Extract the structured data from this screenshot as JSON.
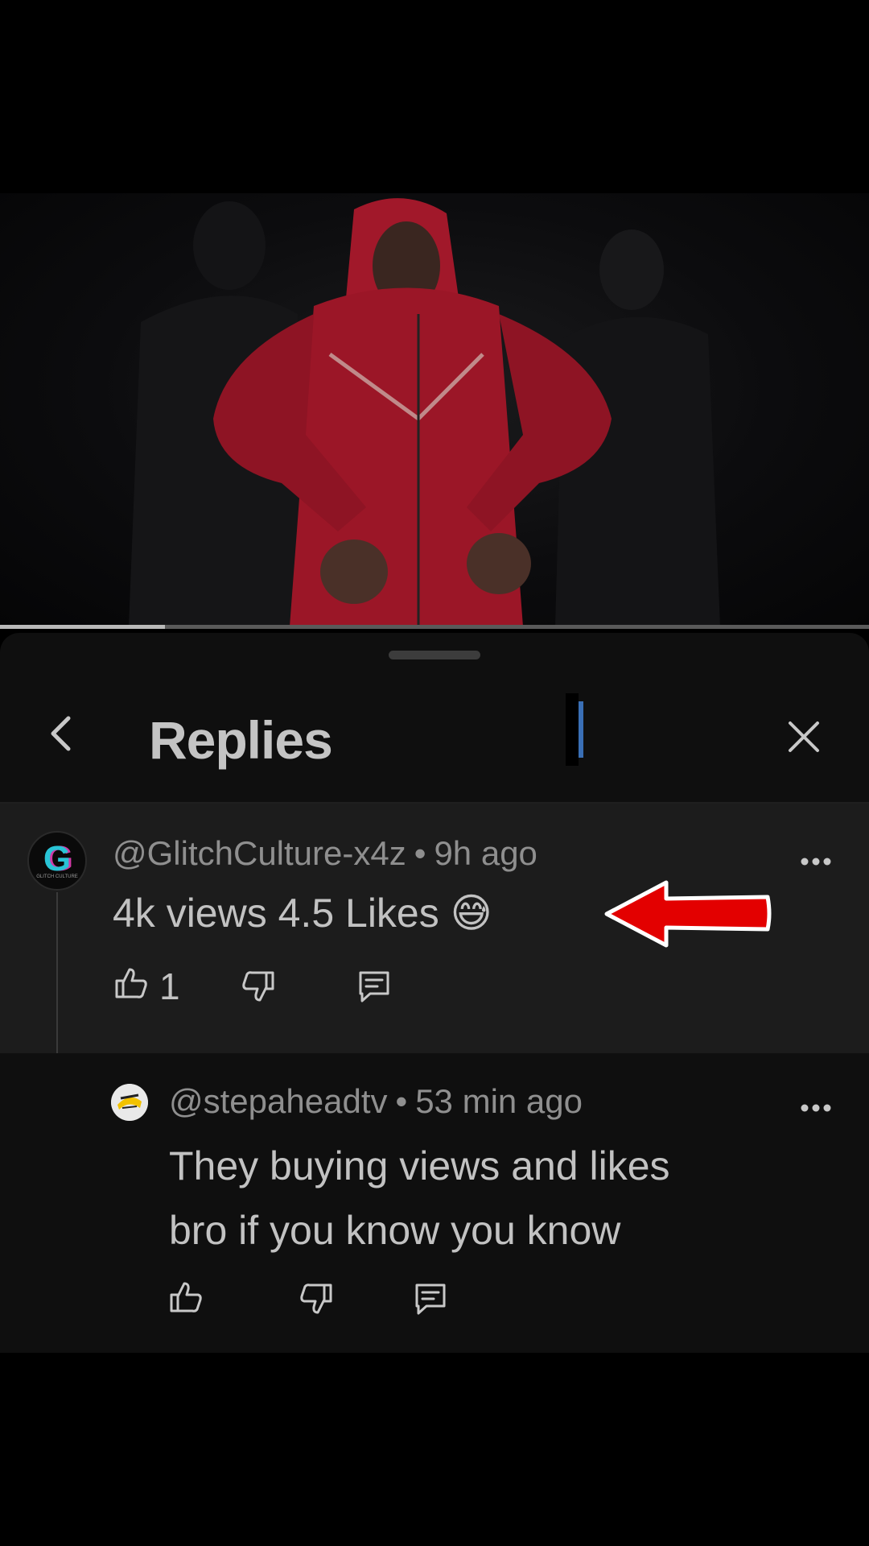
{
  "video": {
    "progress_fraction": 0.19
  },
  "sheet": {
    "title": "Replies"
  },
  "comments": [
    {
      "author": "@GlitchCulture-x4z",
      "time": "9h ago",
      "text": "4k views 4.5 Likes",
      "emoji": "😅",
      "likes": "1",
      "avatar_text": "G",
      "avatar_caption": "GLITCH CULTURE"
    },
    {
      "author": "@stepaheadtv",
      "time": "53 min ago",
      "text_line1": "They buying views and likes",
      "text_line2": "bro if you know you know"
    }
  ],
  "separator": "•",
  "annotation": {
    "arrow_color": "#e30000"
  },
  "icons": {
    "back": "chevron-left-icon",
    "close": "close-icon",
    "more": "more-horizontal-icon",
    "like": "thumbs-up-icon",
    "dislike": "thumbs-down-icon",
    "reply": "comment-icon"
  }
}
